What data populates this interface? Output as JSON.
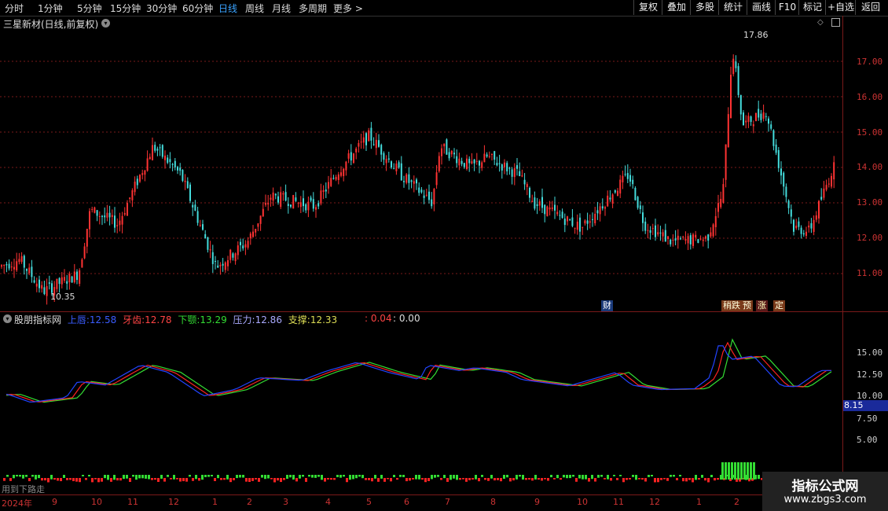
{
  "toolbar": {
    "periods": [
      "分时",
      "1分钟",
      "5分钟",
      "15分钟",
      "30分钟",
      "60分钟",
      "日线",
      "周线",
      "月线",
      "多周期",
      "更多"
    ],
    "active_period": "日线",
    "buttons": [
      "复权",
      "叠加",
      "多股",
      "统计",
      "画线",
      "F10",
      "标记",
      "+自选",
      "返回"
    ]
  },
  "main_chart": {
    "title": "三星新材(日线,前复权)",
    "price_labels": [
      "17.00",
      "16.00",
      "15.00",
      "14.00",
      "13.00",
      "12.00",
      "11.00"
    ],
    "high_label": "17.86",
    "low_label": "10.35",
    "badges": [
      "财",
      "稍跌",
      "预",
      "涨",
      "定"
    ]
  },
  "indicator": {
    "name": "股朋指标网",
    "items": [
      {
        "label": "上唇:",
        "value": "12.58",
        "color": "#3a5cff"
      },
      {
        "label": "牙齿:",
        "value": "12.78",
        "color": "#ff4444"
      },
      {
        "label": "下颚:",
        "value": "13.29",
        "color": "#33dd33"
      },
      {
        "label": "压力:",
        "value": "12.86",
        "color": "#aaaaff"
      },
      {
        "label": "支撑:",
        "value": "12.33",
        "color": "#dddd55"
      }
    ],
    "extra1": ": 0.04",
    "extra2": ": 0.00",
    "axis_labels": [
      "15.00",
      "12.50",
      "10.00",
      "7.50",
      "5.00"
    ],
    "current_value": "8.15",
    "bottom_text": "用到下路走"
  },
  "x_axis": [
    "2024年",
    "9",
    "10",
    "11",
    "12",
    "1",
    "2",
    "3",
    "4",
    "5",
    "6",
    "7",
    "8",
    "9",
    "10",
    "11",
    "12",
    "1",
    "2"
  ],
  "watermark": {
    "title": "指标公式网",
    "url": "www.zbgs3.com"
  },
  "colors": {
    "up": "#ff3333",
    "down": "#44dddd",
    "grid": "#7a1a1a",
    "upper_lip": "#2244ff",
    "teeth": "#ff2222",
    "jaw": "#33dd33"
  }
}
